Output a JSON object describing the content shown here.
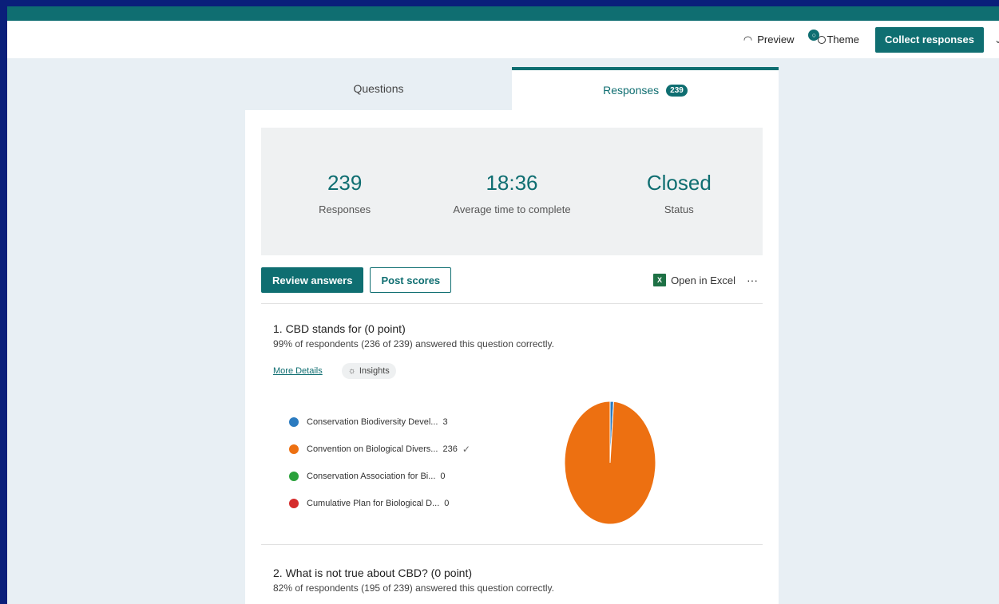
{
  "colors": {
    "accent": "#0f6e71",
    "blue": "#2b7bc0",
    "orange": "#ed7011",
    "green": "#2aa13b",
    "red": "#d52b2b"
  },
  "commandbar": {
    "preview_label": "Preview",
    "theme_label": "Theme",
    "collect_label": "Collect responses"
  },
  "tabs": {
    "questions_label": "Questions",
    "responses_label": "Responses",
    "responses_count": "239"
  },
  "summary": {
    "responses_value": "239",
    "responses_label": "Responses",
    "avg_time_value": "18:36",
    "avg_time_label": "Average time to complete",
    "status_value": "Closed",
    "status_label": "Status"
  },
  "actions": {
    "review_label": "Review answers",
    "post_label": "Post scores",
    "excel_label": "Open in Excel",
    "more_label": "···"
  },
  "question1": {
    "title": "1. CBD stands for (0 point)",
    "stats": "99% of respondents (236 of 239) answered this question correctly.",
    "more_details": "More Details",
    "insights": "Insights",
    "options": [
      {
        "label": "Conservation Biodiversity  Devel...",
        "count": "3",
        "color": "#2b7bc0",
        "value": 3
      },
      {
        "label": "Convention on Biological Divers...",
        "count": "236",
        "color": "#ed7011",
        "value": 236,
        "correct": "✓"
      },
      {
        "label": "Conservation Association for Bi...",
        "count": "0",
        "color": "#2aa13b",
        "value": 0
      },
      {
        "label": "Cumulative Plan for Biological D...",
        "count": "0",
        "color": "#d52b2b",
        "value": 0
      }
    ]
  },
  "question2": {
    "title": "2. What is not true about CBD? (0 point)",
    "stats": "82% of respondents (195 of 239) answered this question correctly."
  }
}
